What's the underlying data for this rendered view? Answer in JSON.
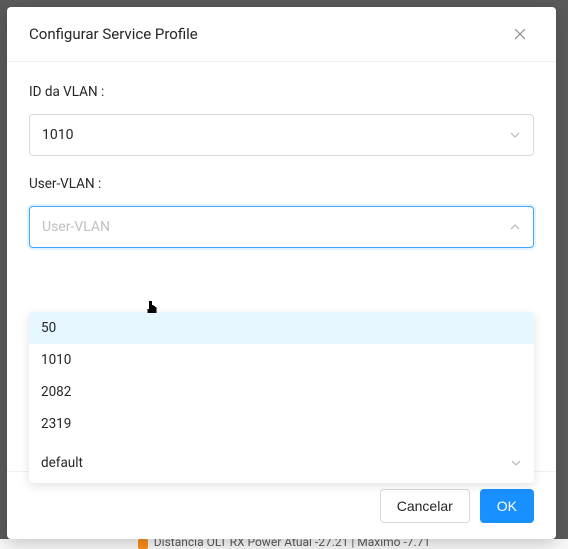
{
  "modal": {
    "title": "Configurar Service Profile"
  },
  "fields": {
    "vlan_id": {
      "label": "ID da VLAN :",
      "value": "1010"
    },
    "user_vlan": {
      "label": "User-VLAN :",
      "placeholder": "User-VLAN",
      "options": [
        "50",
        "1010",
        "2082",
        "2319"
      ]
    },
    "profile": {
      "value": "default"
    }
  },
  "footer": {
    "cancel": "Cancelar",
    "ok": "OK"
  },
  "background": {
    "status": "Distância OLT RX Power Atual -27.21 | Máximo -7.71"
  }
}
